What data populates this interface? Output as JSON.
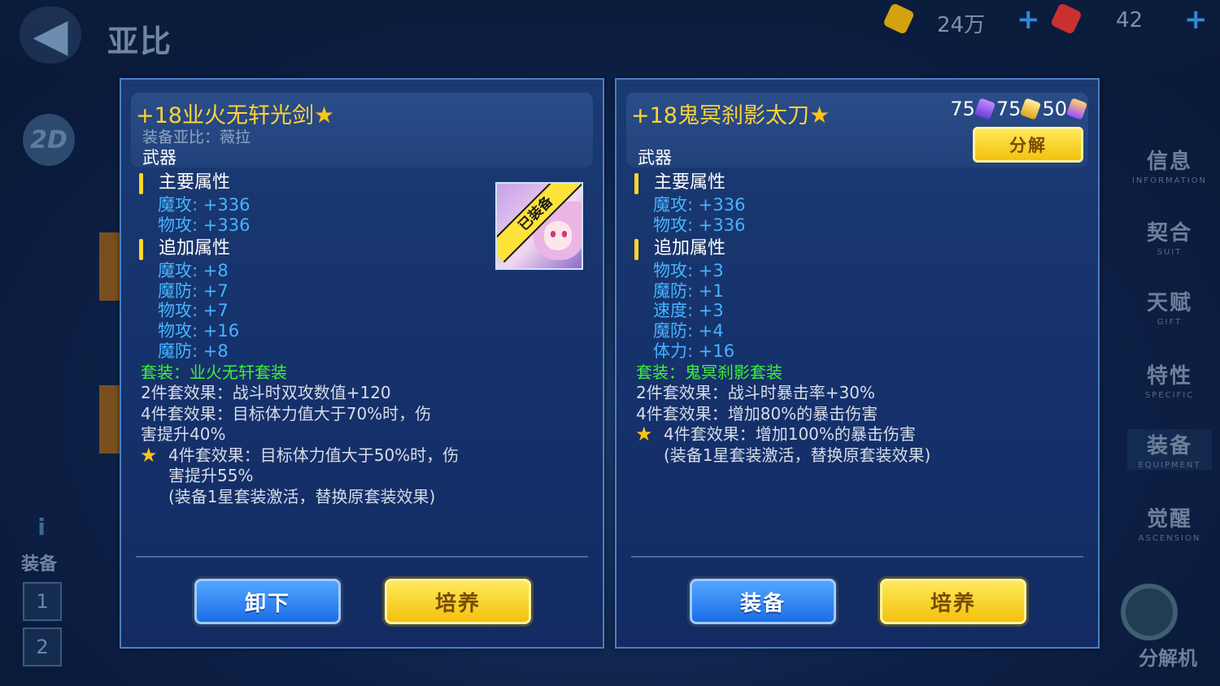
{
  "top": {
    "title": "亚比",
    "gold": "24万",
    "gems": "42"
  },
  "side_badge": "2D",
  "left_nav": {
    "label": "装备",
    "slots": [
      "1",
      "2"
    ]
  },
  "side_menu": [
    {
      "cn": "信息",
      "en": "INFORMATION"
    },
    {
      "cn": "契合",
      "en": "SUIT"
    },
    {
      "cn": "天赋",
      "en": "GIFT"
    },
    {
      "cn": "特性",
      "en": "SPECIFIC"
    },
    {
      "cn": "装备",
      "en": "EQUIPMENT"
    },
    {
      "cn": "觉醒",
      "en": "ASCENSION"
    }
  ],
  "decomposer_label": "分解机",
  "left_panel": {
    "name": "+18业火无轩光剑",
    "owner": "装备亚比：薇拉",
    "slot_type": "武器",
    "equipped_tag": "已装备",
    "main_title": "主要属性",
    "main_stats": [
      "魔攻: +336",
      "物攻: +336"
    ],
    "extra_title": "追加属性",
    "extra_stats": [
      "魔攻: +8",
      "魔防: +7",
      "物攻: +7",
      "物攻: +16",
      "魔防: +8"
    ],
    "set_name": "套装：业火无轩套装",
    "set_lines": [
      "2件套效果：战斗时双攻数值+120",
      "4件套效果：目标体力值大于70%时，伤",
      "害提升40%"
    ],
    "star_line": "4件套效果：目标体力值大于50%时，伤",
    "star_sub": [
      "害提升55%",
      "(装备1星套装激活，替换原套装效果)"
    ],
    "btn_primary": "卸下",
    "btn_secondary": "培养"
  },
  "right_panel": {
    "name": "+18鬼冥刹影太刀",
    "costs": [
      "75",
      "75",
      "50"
    ],
    "decompose_label": "分解",
    "slot_type": "武器",
    "main_title": "主要属性",
    "main_stats": [
      "魔攻: +336",
      "物攻: +336"
    ],
    "extra_title": "追加属性",
    "extra_stats": [
      "物攻: +3",
      "魔防: +1",
      "速度: +3",
      "魔防: +4",
      "体力: +16"
    ],
    "set_name": "套装：鬼冥刹影套装",
    "set_lines": [
      "2件套效果：战斗时暴击率+30%",
      "4件套效果：增加80%的暴击伤害"
    ],
    "star_line": "4件套效果：增加100%的暴击伤害",
    "star_sub": [
      "(装备1星套装激活，替换原套装效果)"
    ],
    "btn_primary": "装备",
    "btn_secondary": "培养"
  },
  "colors": {
    "stat_blue": "#46b4ff",
    "set_green": "#3ff03a",
    "title_gold": "#ffd23a"
  }
}
